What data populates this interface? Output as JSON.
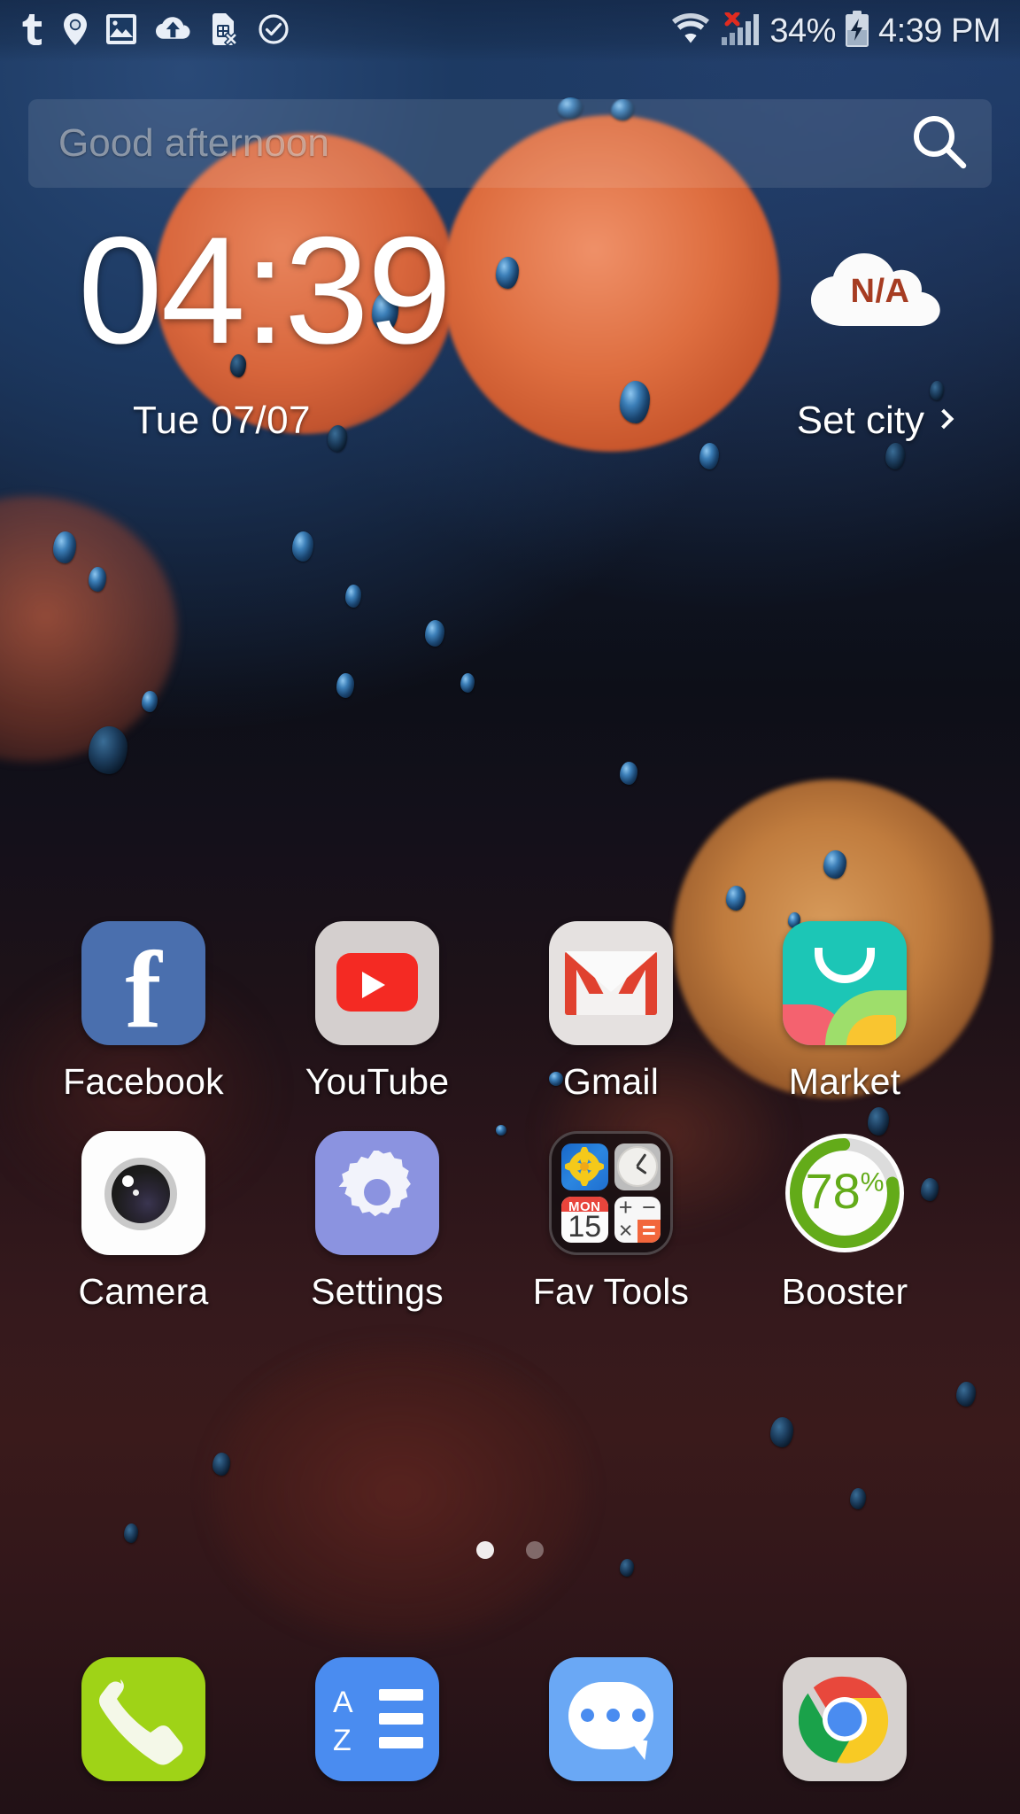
{
  "status_bar": {
    "left_icons": [
      {
        "name": "tumblr-icon",
        "glyph": "t"
      },
      {
        "name": "location-pin-icon",
        "glyph": "pin"
      },
      {
        "name": "gallery-image-icon",
        "glyph": "image"
      },
      {
        "name": "cloud-upload-icon",
        "glyph": "cloud-up"
      },
      {
        "name": "no-sim-card-icon",
        "glyph": "sim-x"
      },
      {
        "name": "check-circle-icon",
        "glyph": "check"
      }
    ],
    "wifi_icon": "wifi-icon",
    "signal_icon": "cellular-signal-no-service-icon",
    "battery_percent": "34%",
    "battery_icon": "battery-charging-icon",
    "clock": "4:39 PM"
  },
  "search": {
    "placeholder": "Good afternoon",
    "icon": "search-icon"
  },
  "clock_widget": {
    "time": "04:39",
    "date": "Tue  07/07",
    "weather_value": "N/A",
    "weather_icon": "cloud-icon",
    "set_city_label": "Set city",
    "chevron": "chevron-right-icon"
  },
  "app_grid": {
    "rows": [
      [
        {
          "label": "Facebook",
          "icon": "facebook-icon"
        },
        {
          "label": "YouTube",
          "icon": "youtube-icon"
        },
        {
          "label": "Gmail",
          "icon": "gmail-icon"
        },
        {
          "label": "Market",
          "icon": "market-icon"
        }
      ],
      [
        {
          "label": "Camera",
          "icon": "camera-icon"
        },
        {
          "label": "Settings",
          "icon": "settings-gear-icon"
        },
        {
          "label": "Fav Tools",
          "icon": "folder-icon"
        },
        {
          "label": "Booster",
          "icon": "booster-ring-icon"
        }
      ]
    ],
    "folder_contents": [
      {
        "name": "gallery-mini-icon"
      },
      {
        "name": "clock-mini-icon"
      },
      {
        "name": "calendar-mini-icon",
        "weekday": "MON",
        "day": "15"
      },
      {
        "name": "calculator-mini-icon",
        "keys": [
          "+",
          "−",
          "×",
          "="
        ]
      }
    ],
    "booster": {
      "value": "78",
      "unit": "%",
      "progress": 78,
      "ring_color": "#63ab19",
      "track_color": "#dcdcdc"
    }
  },
  "page_indicator": {
    "total": 2,
    "active_index": 0
  },
  "dock": [
    {
      "label": "Phone",
      "icon": "phone-icon"
    },
    {
      "label": "App Drawer",
      "icon": "app-drawer-az-icon"
    },
    {
      "label": "Messages",
      "icon": "messages-bubble-icon"
    },
    {
      "label": "Chrome",
      "icon": "chrome-icon"
    }
  ]
}
